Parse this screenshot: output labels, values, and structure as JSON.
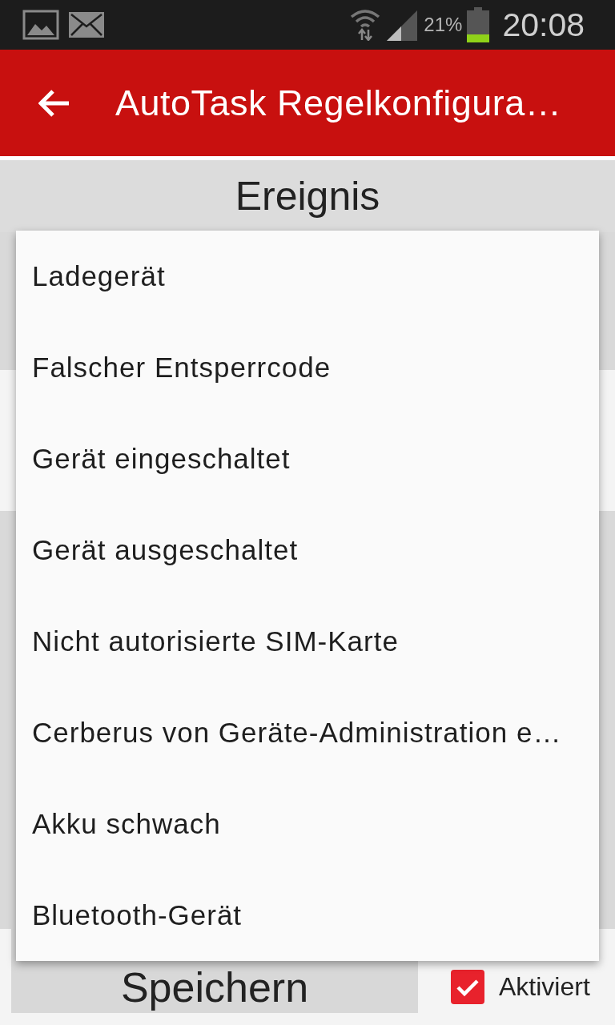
{
  "status_bar": {
    "battery_percent": "21%",
    "time": "20:08"
  },
  "app_bar": {
    "title": "AutoTask Regelkonfigura…"
  },
  "section": {
    "title": "Ereignis"
  },
  "dropdown": {
    "items": [
      {
        "label": "Ladegerät",
        "selected": false
      },
      {
        "label": "Falscher Entsperrcode",
        "selected": false
      },
      {
        "label": "Gerät eingeschaltet",
        "selected": false
      },
      {
        "label": "Gerät ausgeschaltet",
        "selected": false
      },
      {
        "label": "Nicht autorisierte SIM-Karte",
        "selected": false
      },
      {
        "label": "Cerberus von Geräte-Administration e…",
        "selected": false
      },
      {
        "label": "Akku schwach",
        "selected": false
      },
      {
        "label": "Bluetooth-Gerät",
        "selected": false
      }
    ]
  },
  "footer": {
    "save_button": {
      "label": "Speichern"
    },
    "enabled_checkbox": {
      "label": "Aktiviert",
      "checked": true
    }
  }
}
